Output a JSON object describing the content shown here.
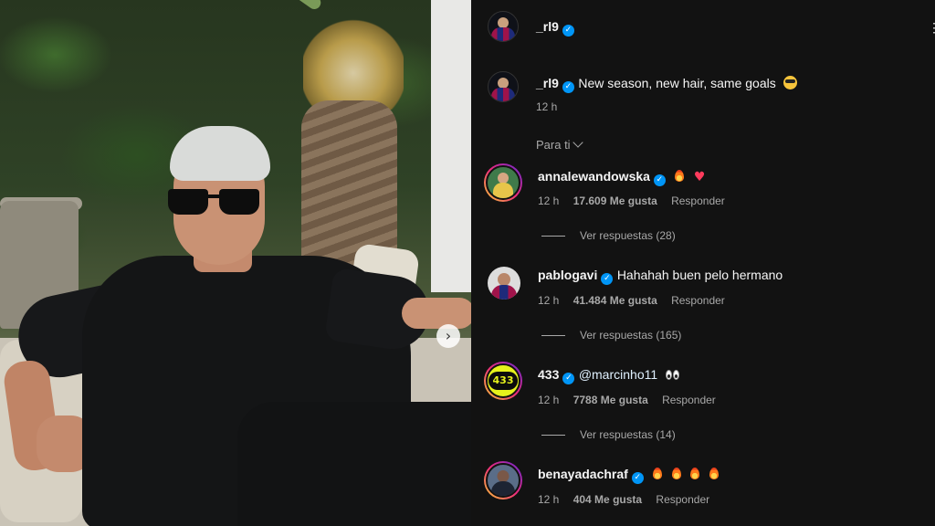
{
  "post": {
    "author": "_rl9",
    "caption": "New season, new hair, same goals",
    "caption_emoji": "smiling-face-with-sunglasses",
    "time": "12 h"
  },
  "icons": {
    "verified": "verified-badge-icon",
    "more": "more-options-icon",
    "next": "chevron-right-icon"
  },
  "glyphs": {
    "check": "✓",
    "next": "›",
    "more": "⋮"
  },
  "sort_label": "Para ti",
  "comments": [
    {
      "username": "annalewandowska",
      "verified": true,
      "text": "",
      "emojis": [
        "fire",
        "heart"
      ],
      "time": "12 h",
      "likes": "17.609 Me gusta",
      "reply_label": "Responder",
      "view_replies": "Ver respuestas (28)"
    },
    {
      "username": "pablogavi",
      "verified": true,
      "text": "Hahahah buen pelo hermano",
      "emojis": [],
      "time": "12 h",
      "likes": "41.484 Me gusta",
      "reply_label": "Responder",
      "view_replies": "Ver respuestas (165)"
    },
    {
      "username": "433",
      "verified": true,
      "text": "@marcinho11",
      "emojis": [
        "eyes"
      ],
      "time": "12 h",
      "likes": "7788 Me gusta",
      "reply_label": "Responder",
      "view_replies": "Ver respuestas (14)"
    },
    {
      "username": "benayadachraf",
      "verified": true,
      "text": "",
      "emojis": [
        "fire",
        "fire",
        "fire",
        "fire"
      ],
      "time": "12 h",
      "likes": "404 Me gusta",
      "reply_label": "Responder"
    }
  ],
  "colors": {
    "pane_bg": "#121212",
    "text": "#f5f5f5",
    "secondary": "#a8a8a8",
    "verified": "#0095f6"
  },
  "avatar_433_text": "433"
}
